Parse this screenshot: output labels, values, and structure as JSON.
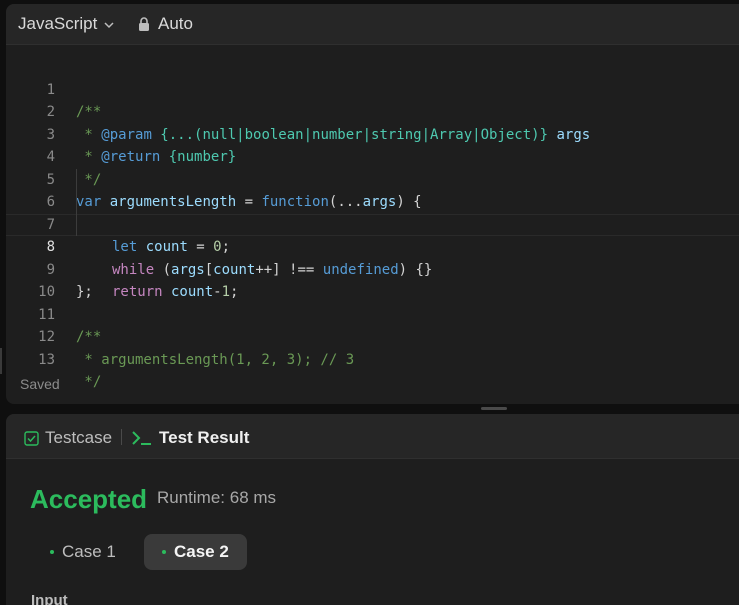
{
  "editor": {
    "language": "JavaScript",
    "mode": "Auto",
    "status": "Saved",
    "lines": [
      {
        "num": "1"
      },
      {
        "num": "2"
      },
      {
        "num": "3"
      },
      {
        "num": "4"
      },
      {
        "num": "5"
      },
      {
        "num": "6"
      },
      {
        "num": "7"
      },
      {
        "num": "8",
        "active": true
      },
      {
        "num": "9"
      },
      {
        "num": "10"
      },
      {
        "num": "11"
      },
      {
        "num": "12"
      },
      {
        "num": "13"
      }
    ],
    "code": {
      "l1": "/**",
      "l2_a": " * ",
      "l2_tag": "@param",
      "l2_type": " {...(null|boolean|number|string|Array|Object)}",
      "l2_name": " args",
      "l3_a": " * ",
      "l3_tag": "@return",
      "l3_type": " {number}",
      "l4": " */",
      "l5_var": "var",
      "l5_name": " argumentsLength",
      "l5_eq": " = ",
      "l5_fn": "function",
      "l5_open": "(...",
      "l5_args": "args",
      "l5_close": ") {",
      "l6_let": "let",
      "l6_count": " count",
      "l6_eq": " = ",
      "l6_zero": "0",
      "l6_semi": ";",
      "l7_while": "while",
      "l7_p1": " (",
      "l7_args": "args",
      "l7_br": "[",
      "l7_count": "count",
      "l7_inc": "++] !== ",
      "l7_undef": "undefined",
      "l7_end": ") {}",
      "l8_ret": "return",
      "l8_count": " count",
      "l8_minus": "-",
      "l8_one": "1",
      "l8_semi": ";",
      "l9": "};",
      "l10": "",
      "l11": "/**",
      "l12": " * argumentsLength(1, 2, 3); // 3",
      "l13": " */"
    }
  },
  "results": {
    "tab_testcase": "Testcase",
    "tab_result": "Test Result",
    "verdict": "Accepted",
    "runtime": "Runtime: 68 ms",
    "cases": [
      "Case 1",
      "Case 2"
    ],
    "input_label": "Input"
  },
  "colors": {
    "accent_green": "#2cbb5d",
    "background": "#1e1e1e"
  }
}
